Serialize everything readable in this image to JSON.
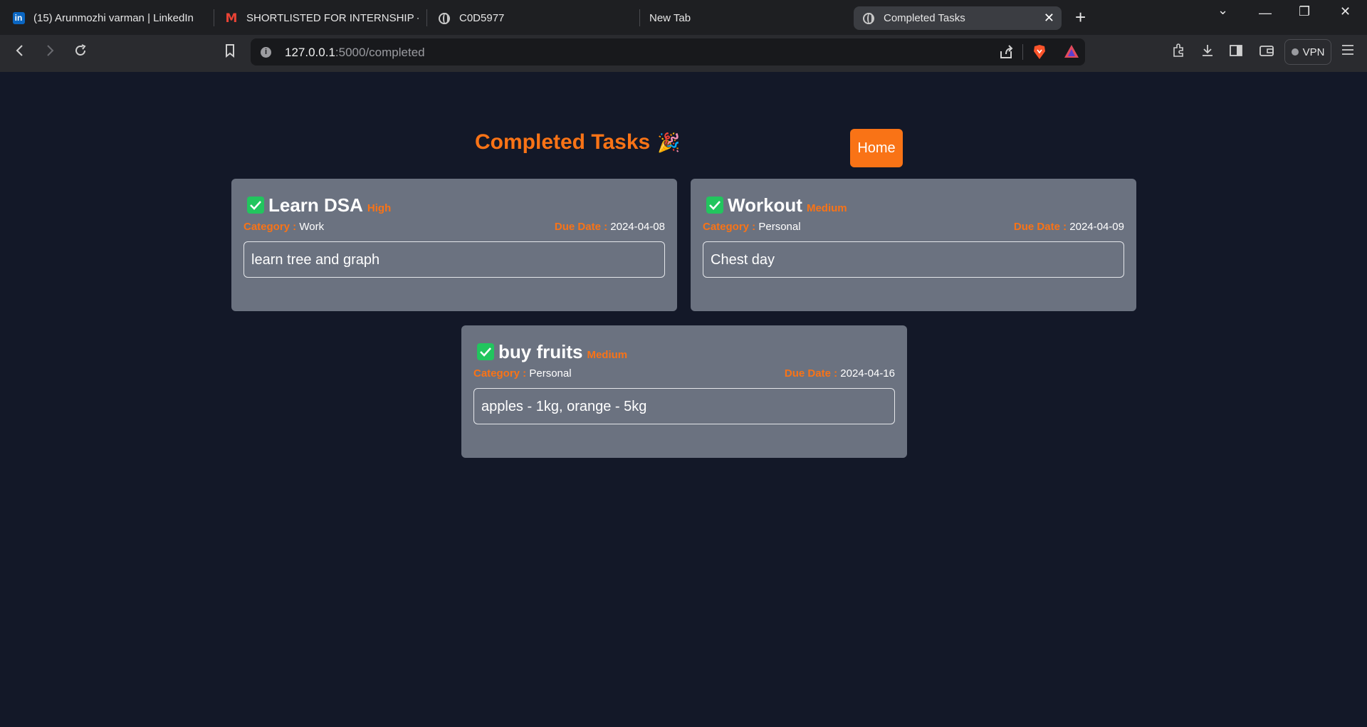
{
  "browser": {
    "tabs": [
      {
        "title": "(15) Arunmozhi varman | LinkedIn",
        "icon": "linkedin-icon"
      },
      {
        "title": "SHORTLISTED FOR INTERNSHIP - am",
        "icon": "gmail-icon"
      },
      {
        "title": "C0D5977",
        "icon": "globe-icon"
      },
      {
        "title": "New Tab",
        "icon": ""
      },
      {
        "title": "Completed Tasks",
        "icon": "globe-icon",
        "active": true
      }
    ],
    "url_host": "127.0.0.1",
    "url_path": ":5000/completed",
    "vpn_label": "VPN"
  },
  "page": {
    "title": "Completed Tasks",
    "title_emoji": "🎉",
    "home_label": "Home",
    "category_label": "Category :",
    "due_label": "Due Date :"
  },
  "tasks": [
    {
      "title": "Learn DSA",
      "priority": "High",
      "category": "Work",
      "due": "2024-04-08",
      "description": "learn tree and graph",
      "completed": true
    },
    {
      "title": "Workout",
      "priority": "Medium",
      "category": "Personal",
      "due": "2024-04-09",
      "description": "Chest day",
      "completed": true
    },
    {
      "title": "buy fruits",
      "priority": "Medium",
      "category": "Personal",
      "due": "2024-04-16",
      "description": "apples - 1kg, orange - 5kg",
      "completed": true
    }
  ],
  "colors": {
    "accent": "#f97316",
    "card": "#6b7280",
    "background": "#131828",
    "check": "#22c55e"
  }
}
